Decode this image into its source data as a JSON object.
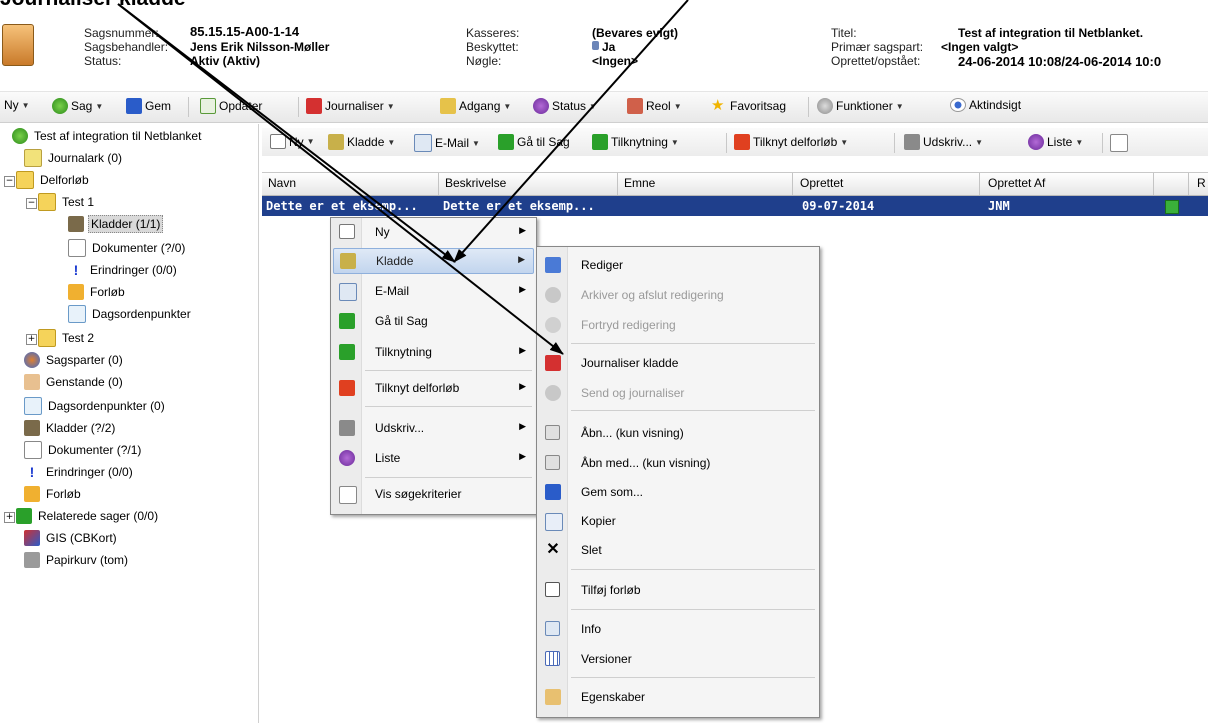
{
  "annotation": {
    "title": "Journaliser kladde"
  },
  "header": {
    "labels": [
      "Sagsnummer:",
      "Sagsbehandler:",
      "Status:"
    ],
    "values": [
      "85.15.15-A00-1-14",
      "Jens Erik Nilsson-Møller",
      "Aktiv (Aktiv)"
    ],
    "labels2": [
      "Kasseres:",
      "Beskyttet:",
      "Nøgle:"
    ],
    "values2": [
      "(Bevares evigt)",
      "Ja",
      "<Ingen>"
    ],
    "labels3": [
      "Titel:",
      "Primær sagspart:",
      "Oprettet/opstået:"
    ],
    "values3": [
      "Test af integration til Netblanket.",
      "<Ingen valgt>",
      "24-06-2014 10:08/24-06-2014 10:0"
    ]
  },
  "toolbar": {
    "items": [
      "Ny",
      "Sag",
      "Gem",
      "Opdater",
      "Journaliser",
      "Adgang",
      "Status",
      "Reol",
      "Favoritsag",
      "Funktioner",
      "Aktindsigt"
    ]
  },
  "tree": {
    "root": "Test af integration til Netblanket",
    "items": [
      "Journalark (0)",
      "Delforløb",
      "Test 1",
      "Kladder (1/1)",
      "Dokumenter (?/0)",
      "Erindringer (0/0)",
      "Forløb",
      "Dagsordenpunkter",
      "Test 2",
      "Sagsparter (0)",
      "Genstande (0)",
      "Dagsordenpunkter (0)",
      "Kladder (?/2)",
      "Dokumenter (?/1)",
      "Erindringer (0/0)",
      "Forløb",
      "Relaterede sager (0/0)",
      "GIS (CBKort)",
      "Papirkurv (tom)"
    ]
  },
  "rtoolbar": {
    "items": [
      "Ny",
      "Kladde",
      "E-Mail",
      "Gå til Sag",
      "Tilknytning",
      "Tilknyt delforløb",
      "Udskriv...",
      "Liste"
    ]
  },
  "grid": {
    "headers": [
      "Navn",
      "Beskrivelse",
      "Emne",
      "Oprettet",
      "Oprettet Af",
      "",
      "R"
    ],
    "row": [
      "Dette er et eksemp...",
      "Dette er et eksemp...",
      "",
      "09-07-2014",
      "JNM"
    ]
  },
  "menu1": {
    "items": [
      "Ny",
      "Kladde",
      "E-Mail",
      "Gå til Sag",
      "Tilknytning",
      "Tilknyt delforløb",
      "Udskriv...",
      "Liste",
      "Vis søgekriterier"
    ]
  },
  "menu2": {
    "items": [
      "Rediger",
      "Arkiver og afslut redigering",
      "Fortryd redigering",
      "Journaliser kladde",
      "Send og journaliser",
      "Åbn... (kun visning)",
      "Åbn med... (kun visning)",
      "Gem som...",
      "Kopier",
      "Slet",
      "Tilføj forløb",
      "Info",
      "Versioner",
      "Egenskaber"
    ]
  },
  "colors": {
    "selection": "#1f3f8c",
    "menu_highlight": "#c2d5ee"
  }
}
